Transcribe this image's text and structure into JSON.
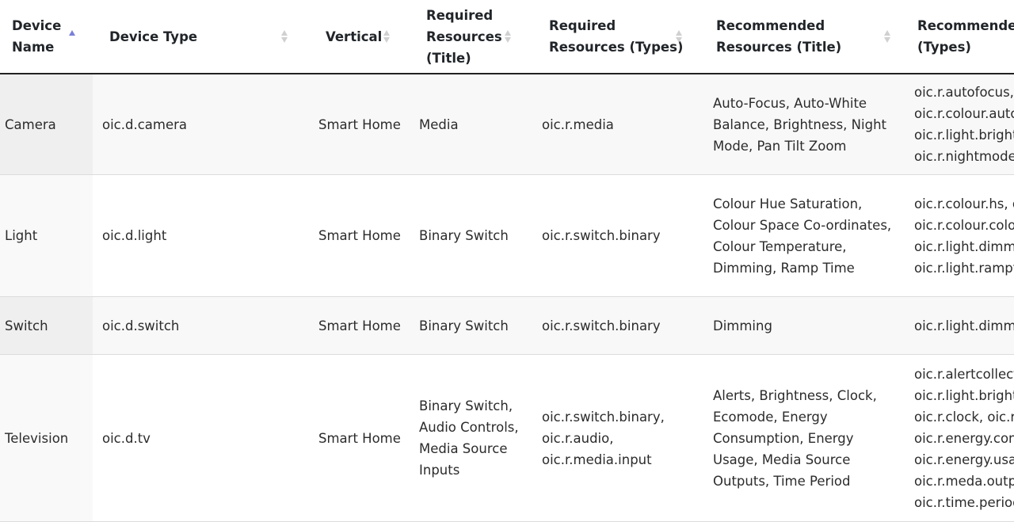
{
  "table": {
    "headers": [
      {
        "label_lines": [
          "Device",
          "Name"
        ],
        "sort": "asc"
      },
      {
        "label_lines": [
          "Device Type"
        ],
        "sort": "none"
      },
      {
        "label_lines": [
          "Vertical"
        ],
        "sort": "none"
      },
      {
        "label_lines": [
          "Required",
          "Resources",
          "(Title)"
        ],
        "sort": "none"
      },
      {
        "label_lines": [
          "Required",
          "Resources (Types)"
        ],
        "sort": "none"
      },
      {
        "label_lines": [
          "Recommended",
          "Resources (Title)"
        ],
        "sort": "none"
      },
      {
        "label_lines": [
          "Recommended Resources",
          "(Types)"
        ],
        "sort": "none"
      }
    ],
    "sort_colors": {
      "active": "#7b7fd8",
      "inactive": "#d0d0d0"
    },
    "rows": [
      {
        "device_name": "Camera",
        "device_type": "oic.d.camera",
        "vertical": "Smart Home",
        "required_title": "Media",
        "required_types": "oic.r.media",
        "recommended_title": "Auto-Focus, Auto-White Balance, Brightness, Night Mode, Pan Tilt Zoom",
        "recommended_types_lines": [
          "oic.r.autofocus,",
          "oic.r.colour.autowhitebalance,",
          "oic.r.light.brightness,",
          "oic.r.nightmode, oic.r.ptz"
        ]
      },
      {
        "device_name": "Light",
        "device_type": "oic.d.light",
        "vertical": "Smart Home",
        "required_title": "Binary Switch",
        "required_types": "oic.r.switch.binary",
        "recommended_title": "Colour Hue Saturation, Colour Space Co-ordinates, Colour Temperature, Dimming, Ramp Time",
        "recommended_types_lines": [
          "oic.r.colour.hs, oic.r.colour.csc,",
          "oic.r.colour.colourtemperature,",
          "oic.r.light.dimming,",
          "oic.r.light.ramptime"
        ]
      },
      {
        "device_name": "Switch",
        "device_type": "oic.d.switch",
        "vertical": "Smart Home",
        "required_title": "Binary Switch",
        "required_types": "oic.r.switch.binary",
        "recommended_title": "Dimming",
        "recommended_types_lines": [
          "oic.r.light.dimming"
        ]
      },
      {
        "device_name": "Television",
        "device_type": "oic.d.tv",
        "vertical": "Smart Home",
        "required_title": "Binary Switch, Audio Controls, Media Source Inputs",
        "required_types": "oic.r.switch.binary, oic.r.audio, oic.r.media.input",
        "recommended_title": "Alerts, Brightness, Clock, Ecomode, Energy Consumption, Energy Usage, Media Source Outputs, Time Period",
        "recommended_types_lines": [
          "oic.r.alertcollection,",
          "oic.r.light.brightness,",
          "oic.r.clock, oic.r.ecomode,",
          "oic.r.energy.consumption,",
          "oic.r.energy.usage,",
          "oic.r.meda.output,",
          "oic.r.time.period"
        ]
      }
    ]
  }
}
